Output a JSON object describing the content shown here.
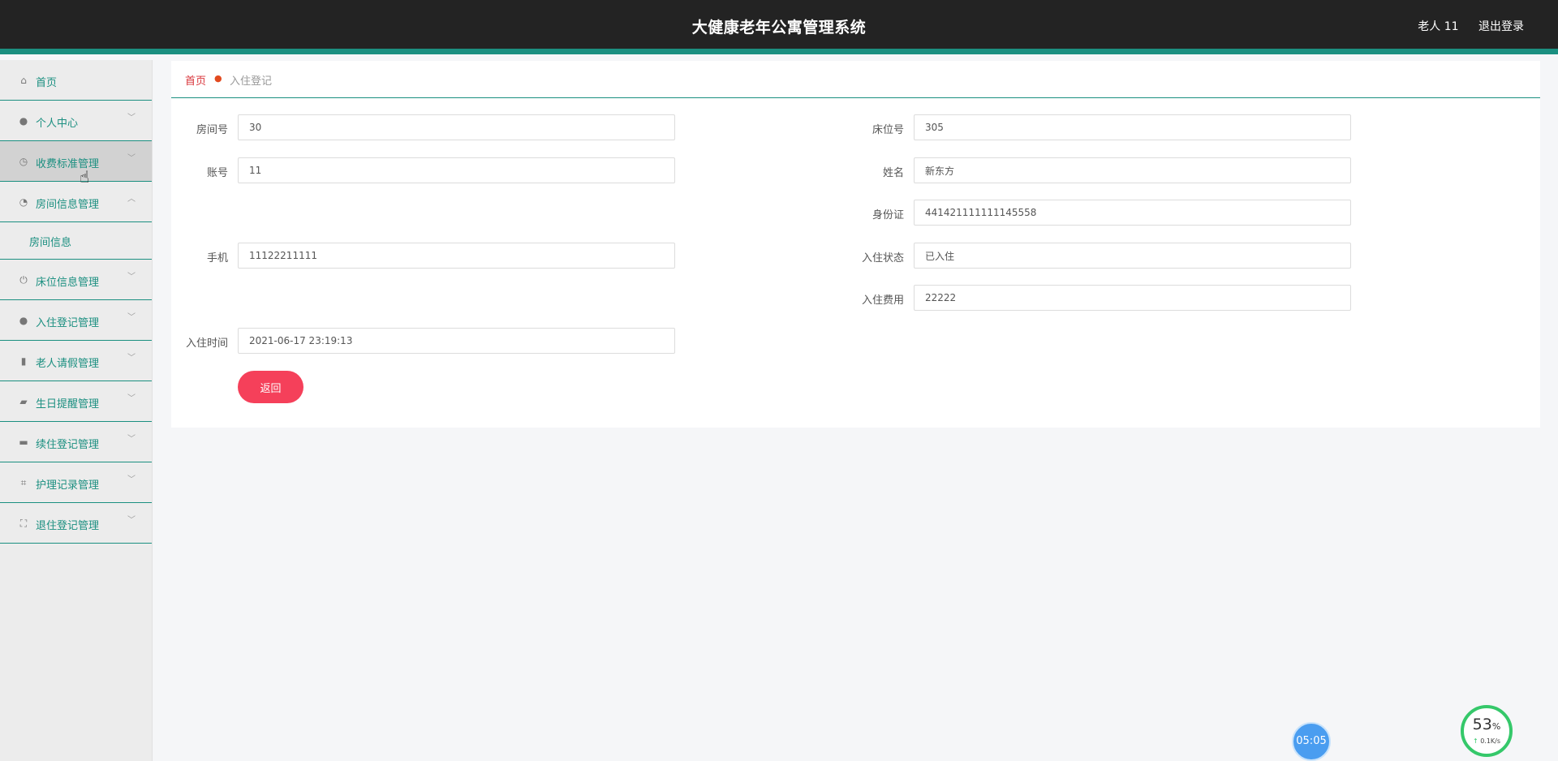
{
  "header": {
    "title": "大健康老年公寓管理系统",
    "user": "老人 11",
    "logout": "退出登录"
  },
  "sidebar": {
    "items": [
      {
        "label": "首页",
        "icon": "home-icon"
      },
      {
        "label": "个人中心",
        "icon": "user-icon"
      },
      {
        "label": "收费标准管理",
        "icon": "clock-icon"
      },
      {
        "label": "房间信息管理",
        "icon": "dashboard-icon"
      },
      {
        "label": "房间信息",
        "icon": ""
      },
      {
        "label": "床位信息管理",
        "icon": "power-icon"
      },
      {
        "label": "入住登记管理",
        "icon": "user-icon"
      },
      {
        "label": "老人请假管理",
        "icon": "bar-chart-icon"
      },
      {
        "label": "生日提醒管理",
        "icon": "wallet-icon"
      },
      {
        "label": "续住登记管理",
        "icon": "monitor-icon"
      },
      {
        "label": "护理记录管理",
        "icon": "crop-icon"
      },
      {
        "label": "退住登记管理",
        "icon": "fullscreen-icon"
      }
    ]
  },
  "breadcrumb": {
    "home": "首页",
    "current": "入住登记"
  },
  "form": {
    "room_no": {
      "label": "房间号",
      "value": "30"
    },
    "bed_no": {
      "label": "床位号",
      "value": "305"
    },
    "account": {
      "label": "账号",
      "value": "11"
    },
    "name": {
      "label": "姓名",
      "value": "新东方"
    },
    "id_card": {
      "label": "身份证",
      "value": "441421111111145558"
    },
    "phone": {
      "label": "手机",
      "value": "11122211111"
    },
    "status": {
      "label": "入住状态",
      "value": "已入住"
    },
    "fee": {
      "label": "入住费用",
      "value": "22222"
    },
    "checkin_time": {
      "label": "入住时间",
      "value": "2021-06-17 23:19:13"
    },
    "back_label": "返回"
  },
  "widgets": {
    "timer": "05:05",
    "speed_percent": "53",
    "speed_unit": "%",
    "speed_rate": "0.1K/s"
  },
  "colors": {
    "accent": "#1b8f80",
    "danger": "#f5405a",
    "topbar": "#232323"
  }
}
